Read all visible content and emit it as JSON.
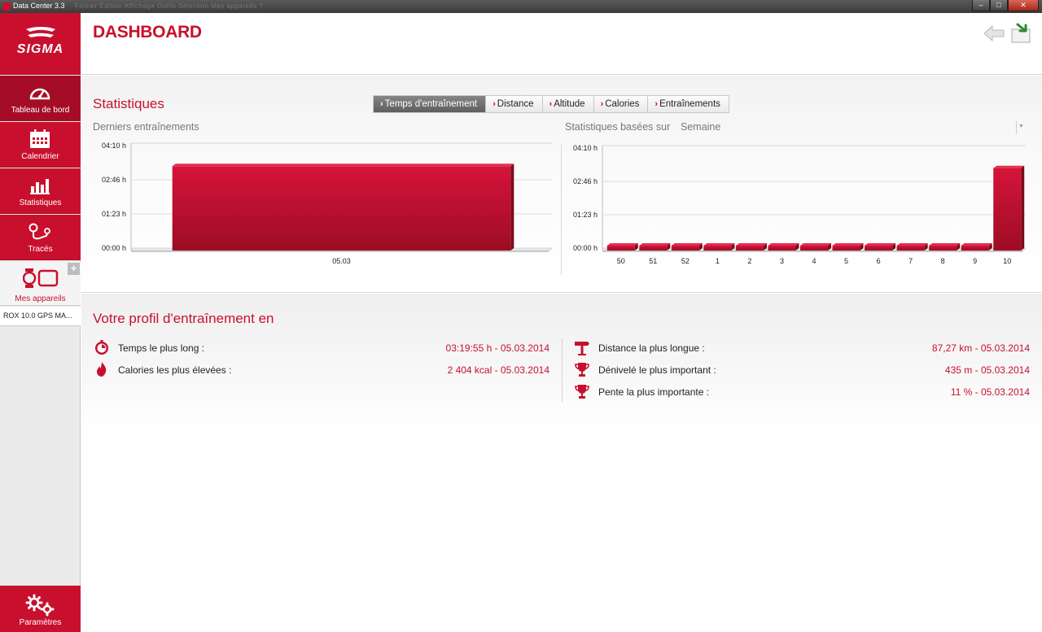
{
  "window": {
    "title": "Data Center 3.3",
    "menu_ghost": "Fichier   Édition   Affichage   Outils   Sélection   Mes appareils   ?"
  },
  "sidebar": {
    "brand": "SIGMA",
    "items": [
      {
        "label": "Tableau de bord",
        "icon": "speedometer-icon",
        "active": true
      },
      {
        "label": "Calendrier",
        "icon": "calendar-icon",
        "active": false
      },
      {
        "label": "Statistiques",
        "icon": "bar-chart-icon",
        "active": false
      },
      {
        "label": "Tracés",
        "icon": "route-icon",
        "active": false
      }
    ],
    "devices_label": "Mes appareils",
    "device_name": "ROX 10.0 GPS MA...",
    "settings_label": "Paramètres"
  },
  "header": {
    "title": "DASHBOARD"
  },
  "statistics": {
    "title": "Statistiques",
    "tabs": [
      {
        "label": "Temps d'entraînement",
        "active": true
      },
      {
        "label": "Distance",
        "active": false
      },
      {
        "label": "Altitude",
        "active": false
      },
      {
        "label": "Calories",
        "active": false
      },
      {
        "label": "Entraînements",
        "active": false
      }
    ],
    "left_subtitle": "Derniers entraînements",
    "right_subtitle": "Statistiques basées sur",
    "right_period": "Semaine"
  },
  "chart_data": [
    {
      "type": "bar",
      "title": "Derniers entraînements",
      "categories": [
        "05.03"
      ],
      "values": [
        3.33
      ],
      "ylabel": "",
      "y_ticks": [
        "00:00 h",
        "01:23 h",
        "02:46 h",
        "04:10 h"
      ],
      "ylim": [
        0,
        4.167
      ],
      "bar_color": "#c8102e"
    },
    {
      "type": "bar",
      "title": "Statistiques basées sur Semaine",
      "categories": [
        "50",
        "51",
        "52",
        "1",
        "2",
        "3",
        "4",
        "5",
        "6",
        "7",
        "8",
        "9",
        "10"
      ],
      "values": [
        0,
        0,
        0,
        0,
        0,
        0,
        0,
        0,
        0,
        0,
        0,
        0,
        3.33
      ],
      "ylabel": "",
      "y_ticks": [
        "00:00 h",
        "01:23 h",
        "02:46 h",
        "04:10 h"
      ],
      "ylim": [
        0,
        4.167
      ],
      "bar_color": "#c8102e"
    }
  ],
  "profile": {
    "title": "Votre profil d'entraînement en",
    "left_records": [
      {
        "label": "Temps le plus long :",
        "value": "03:19:55 h - 05.03.2014",
        "icon": "stopwatch-icon"
      },
      {
        "label": "Calories les plus élevées :",
        "value": "2 404 kcal - 05.03.2014",
        "icon": "flame-icon"
      }
    ],
    "right_records": [
      {
        "label": "Distance la plus longue :",
        "value": "87,27 km - 05.03.2014",
        "icon": "signpost-icon"
      },
      {
        "label": "Dénivelé le plus important :",
        "value": "435 m - 05.03.2014",
        "icon": "trophy-icon"
      },
      {
        "label": "Pente la plus importante :",
        "value": "11 % - 05.03.2014",
        "icon": "trophy-icon"
      }
    ]
  },
  "colors": {
    "accent": "#c8102e",
    "sidebar_active": "#a50d26"
  }
}
